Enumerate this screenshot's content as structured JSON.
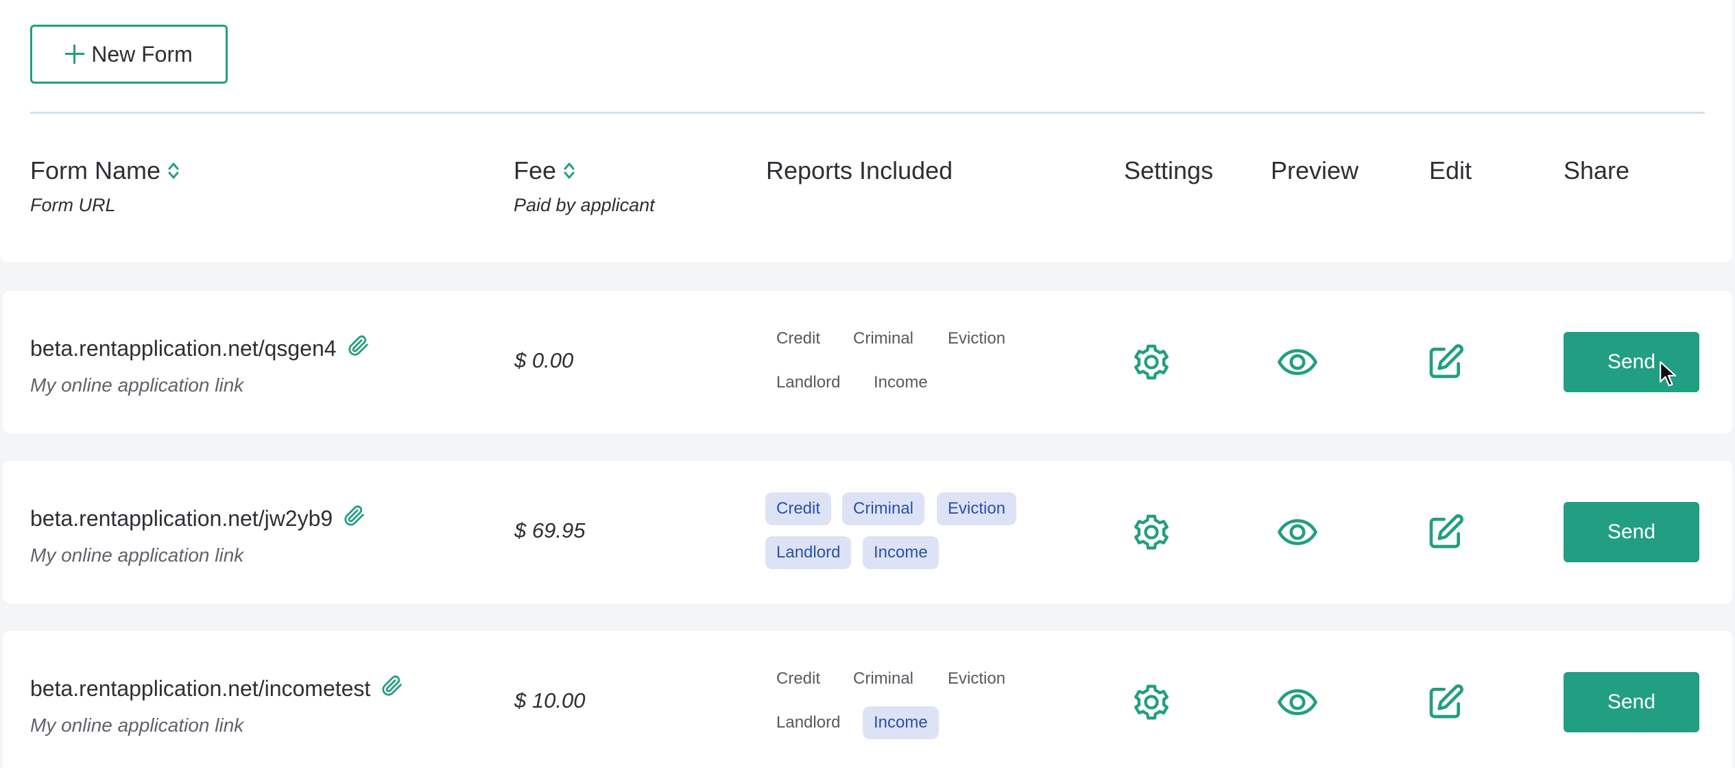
{
  "toolbar": {
    "new_form_label": "New Form"
  },
  "columns": {
    "form_name": "Form Name",
    "form_url_sub": "Form URL",
    "fee": "Fee",
    "fee_sub": "Paid by applicant",
    "reports": "Reports Included",
    "settings": "Settings",
    "preview": "Preview",
    "edit": "Edit",
    "share": "Share"
  },
  "colors": {
    "accent": "#229e82",
    "chip_active_bg": "#dde3f5",
    "chip_active_text": "#2a50a8"
  },
  "rows": [
    {
      "url": "beta.rentapplication.net/qsgen4",
      "description": "My online application link",
      "fee": "$ 0.00",
      "reports": [
        {
          "label": "Credit",
          "active": false
        },
        {
          "label": "Criminal",
          "active": false
        },
        {
          "label": "Eviction",
          "active": false
        },
        {
          "label": "Landlord",
          "active": false
        },
        {
          "label": "Income",
          "active": false
        }
      ],
      "send_label": "Send"
    },
    {
      "url": "beta.rentapplication.net/jw2yb9",
      "description": "My online application link",
      "fee": "$ 69.95",
      "reports": [
        {
          "label": "Credit",
          "active": true
        },
        {
          "label": "Criminal",
          "active": true
        },
        {
          "label": "Eviction",
          "active": true
        },
        {
          "label": "Landlord",
          "active": true
        },
        {
          "label": "Income",
          "active": true
        }
      ],
      "send_label": "Send"
    },
    {
      "url": "beta.rentapplication.net/incometest",
      "description": "My online application link",
      "fee": "$ 10.00",
      "reports": [
        {
          "label": "Credit",
          "active": false
        },
        {
          "label": "Criminal",
          "active": false
        },
        {
          "label": "Eviction",
          "active": false
        },
        {
          "label": "Landlord",
          "active": false
        },
        {
          "label": "Income",
          "active": true
        }
      ],
      "send_label": "Send"
    }
  ],
  "icons": {
    "sort": "sort-icon",
    "attachment": "paperclip-icon",
    "settings": "gear-icon",
    "preview": "eye-icon",
    "edit": "edit-icon"
  }
}
